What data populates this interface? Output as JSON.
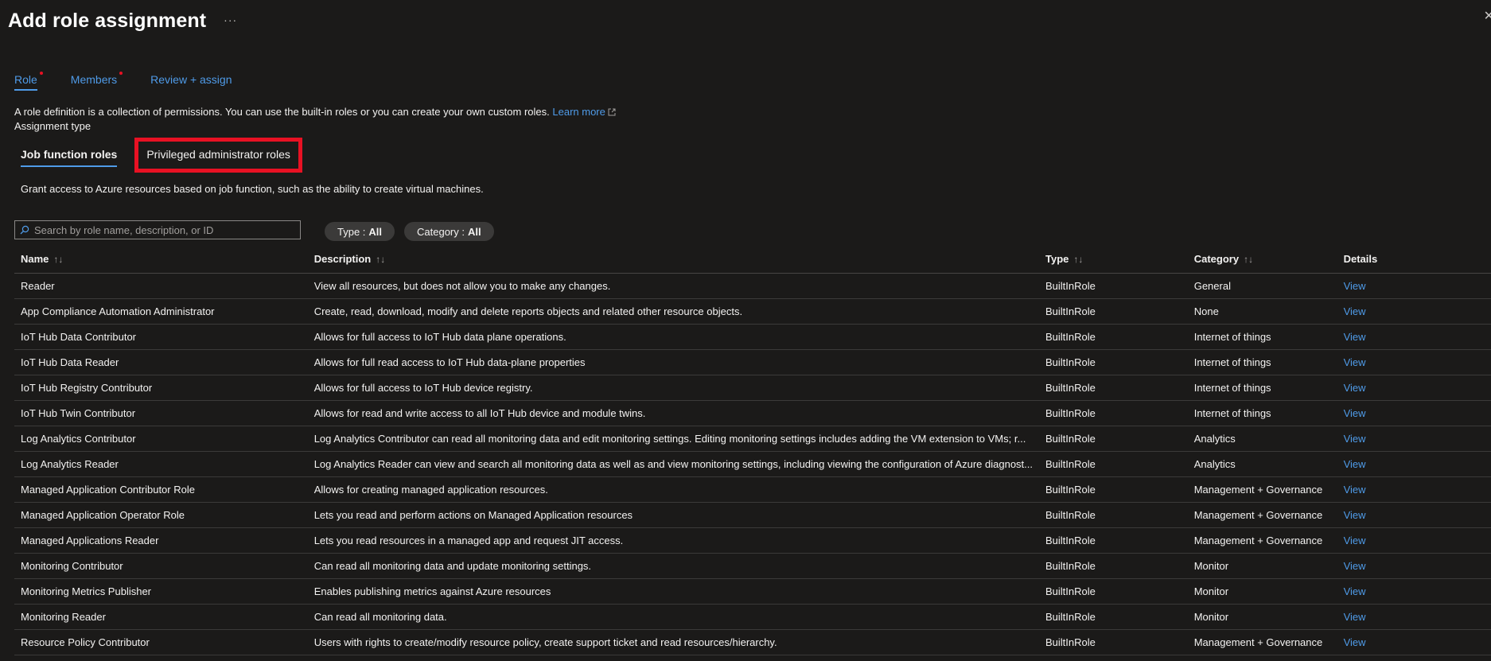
{
  "header": {
    "title": "Add role assignment",
    "more": "···",
    "close": "✕"
  },
  "tabs": [
    {
      "label": "Role",
      "required": true,
      "active": true
    },
    {
      "label": "Members",
      "required": true,
      "active": false
    },
    {
      "label": "Review + assign",
      "required": false,
      "active": false
    }
  ],
  "description": {
    "text": "A role definition is a collection of permissions. You can use the built-in roles or you can create your own custom roles.",
    "learn_more": "Learn more"
  },
  "assignment_type_label": "Assignment type",
  "subtabs": [
    {
      "label": "Job function roles",
      "active": true
    },
    {
      "label": "Privileged administrator roles",
      "active": false,
      "highlighted": true
    }
  ],
  "grant_text": "Grant access to Azure resources based on job function, such as the ability to create virtual machines.",
  "search": {
    "placeholder": "Search by role name, description, or ID",
    "value": ""
  },
  "filters": [
    {
      "label": "Type :",
      "value": "All"
    },
    {
      "label": "Category :",
      "value": "All"
    }
  ],
  "table": {
    "columns": [
      "Name",
      "Description",
      "Type",
      "Category",
      "Details"
    ],
    "sort_icon": "↑↓",
    "rows": [
      {
        "name": "Reader",
        "description": "View all resources, but does not allow you to make any changes.",
        "type": "BuiltInRole",
        "category": "General",
        "details": "View"
      },
      {
        "name": "App Compliance Automation Administrator",
        "description": "Create, read, download, modify and delete reports objects and related other resource objects.",
        "type": "BuiltInRole",
        "category": "None",
        "details": "View"
      },
      {
        "name": "IoT Hub Data Contributor",
        "description": "Allows for full access to IoT Hub data plane operations.",
        "type": "BuiltInRole",
        "category": "Internet of things",
        "details": "View"
      },
      {
        "name": "IoT Hub Data Reader",
        "description": "Allows for full read access to IoT Hub data-plane properties",
        "type": "BuiltInRole",
        "category": "Internet of things",
        "details": "View"
      },
      {
        "name": "IoT Hub Registry Contributor",
        "description": "Allows for full access to IoT Hub device registry.",
        "type": "BuiltInRole",
        "category": "Internet of things",
        "details": "View"
      },
      {
        "name": "IoT Hub Twin Contributor",
        "description": "Allows for read and write access to all IoT Hub device and module twins.",
        "type": "BuiltInRole",
        "category": "Internet of things",
        "details": "View"
      },
      {
        "name": "Log Analytics Contributor",
        "description": "Log Analytics Contributor can read all monitoring data and edit monitoring settings. Editing monitoring settings includes adding the VM extension to VMs; r...",
        "type": "BuiltInRole",
        "category": "Analytics",
        "details": "View"
      },
      {
        "name": "Log Analytics Reader",
        "description": "Log Analytics Reader can view and search all monitoring data as well as and view monitoring settings, including viewing the configuration of Azure diagnost...",
        "type": "BuiltInRole",
        "category": "Analytics",
        "details": "View"
      },
      {
        "name": "Managed Application Contributor Role",
        "description": "Allows for creating managed application resources.",
        "type": "BuiltInRole",
        "category": "Management + Governance",
        "details": "View"
      },
      {
        "name": "Managed Application Operator Role",
        "description": "Lets you read and perform actions on Managed Application resources",
        "type": "BuiltInRole",
        "category": "Management + Governance",
        "details": "View"
      },
      {
        "name": "Managed Applications Reader",
        "description": "Lets you read resources in a managed app and request JIT access.",
        "type": "BuiltInRole",
        "category": "Management + Governance",
        "details": "View"
      },
      {
        "name": "Monitoring Contributor",
        "description": "Can read all monitoring data and update monitoring settings.",
        "type": "BuiltInRole",
        "category": "Monitor",
        "details": "View"
      },
      {
        "name": "Monitoring Metrics Publisher",
        "description": "Enables publishing metrics against Azure resources",
        "type": "BuiltInRole",
        "category": "Monitor",
        "details": "View"
      },
      {
        "name": "Monitoring Reader",
        "description": "Can read all monitoring data.",
        "type": "BuiltInRole",
        "category": "Monitor",
        "details": "View"
      },
      {
        "name": "Resource Policy Contributor",
        "description": "Users with rights to create/modify resource policy, create support ticket and read resources/hierarchy.",
        "type": "BuiltInRole",
        "category": "Management + Governance",
        "details": "View"
      }
    ]
  },
  "colors": {
    "background": "#1b1a19",
    "accent": "#4f9be8",
    "highlight": "#e81123",
    "pill": "#3b3a39"
  }
}
